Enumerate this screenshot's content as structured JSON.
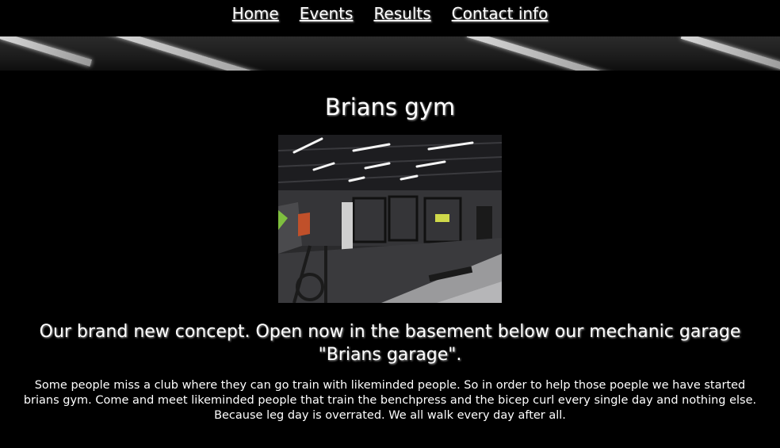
{
  "nav": {
    "home": "Home",
    "events": "Events",
    "results": "Results",
    "contact": "Contact info"
  },
  "main": {
    "title": "Brians gym",
    "subtitle": "Our brand new concept. Open now in the basement below our mechanic garage \"Brians garage\".",
    "description": "Some people miss a club where they can go train with likeminded people. So in order to help those poeple we have started brians gym. Come and meet likeminded people that train the benchpress and the bicep curl every single day and nothing else. Because leg day is overrated. We all walk every day after all."
  },
  "colors": {
    "background": "#000000",
    "text": "#ffffff"
  }
}
